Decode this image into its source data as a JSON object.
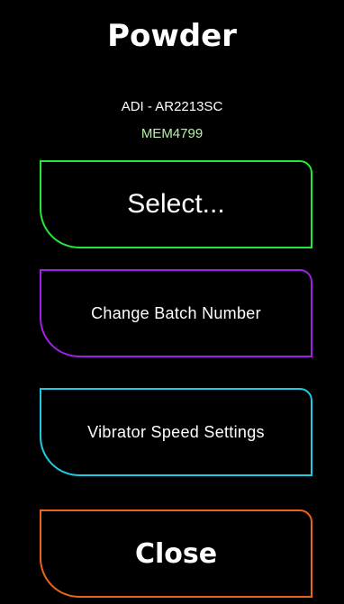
{
  "header": {
    "title": "Powder",
    "product": "ADI - AR2213SC",
    "batch": "MEM4799"
  },
  "buttons": {
    "select": {
      "label": "Select...",
      "color": "#22e83a"
    },
    "change_batch": {
      "label": "Change Batch Number",
      "color": "#a020e8"
    },
    "vibrator_speed": {
      "label": "Vibrator Speed Settings",
      "color": "#1ccde0"
    },
    "close": {
      "label": "Close",
      "color": "#e8651a"
    }
  },
  "colors": {
    "background": "#000000",
    "text": "#ffffff",
    "batch_text": "#b8f0a8"
  }
}
